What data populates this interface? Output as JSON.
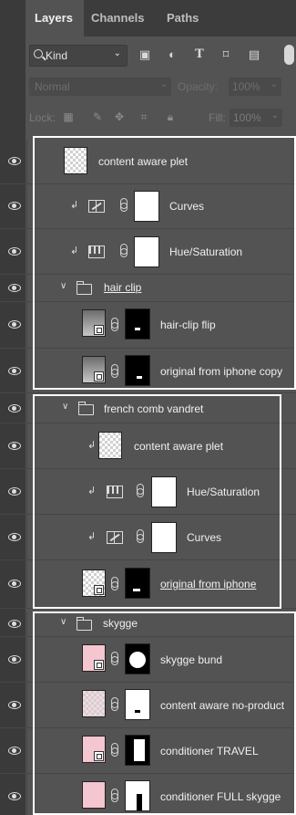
{
  "tabs": [
    {
      "label": "Layers",
      "active": true
    },
    {
      "label": "Channels",
      "active": false
    },
    {
      "label": "Paths",
      "active": false
    }
  ],
  "filter": {
    "kind_label": "Kind",
    "icons": [
      "image-filter-icon",
      "adjustment-filter-icon",
      "type-filter-icon",
      "shape-filter-icon",
      "smart-object-filter-icon"
    ],
    "type_glyph": "T"
  },
  "blend": {
    "mode": "Normal",
    "opacity_label": "Opacity:",
    "opacity_value": "100%"
  },
  "lock": {
    "label": "Lock:",
    "fill_label": "Fill:",
    "fill_value": "100%"
  },
  "colors": {
    "panel": "#535353",
    "tabbar": "#3c3c3c",
    "highlight_border": "#ffffff",
    "text": "#f0f0f0"
  },
  "layers": [
    {
      "name": "content aware plet",
      "kind": "pixel",
      "clipped": false,
      "underlined": false
    },
    {
      "name": "Curves",
      "kind": "curves",
      "clipped": true,
      "underlined": false
    },
    {
      "name": "Hue/Saturation",
      "kind": "hue",
      "clipped": true,
      "underlined": false
    },
    {
      "name": "hair clip",
      "kind": "group",
      "expanded": true,
      "underlined": true
    },
    {
      "name": "hair-clip flip",
      "kind": "smart",
      "underlined": false
    },
    {
      "name": "original from iphone copy",
      "kind": "smart",
      "underlined": false
    },
    {
      "name": "french comb vandret",
      "kind": "group",
      "expanded": true,
      "underlined": false
    },
    {
      "name": "content aware plet",
      "kind": "pixel",
      "clipped": true,
      "underlined": false
    },
    {
      "name": "Hue/Saturation",
      "kind": "hue",
      "clipped": true,
      "underlined": false
    },
    {
      "name": "Curves",
      "kind": "curves",
      "clipped": true,
      "underlined": false
    },
    {
      "name": "original from iphone",
      "kind": "smart",
      "underlined": true
    },
    {
      "name": "skygge",
      "kind": "group",
      "expanded": true,
      "underlined": false
    },
    {
      "name": "skygge bund",
      "kind": "smart",
      "underlined": false
    },
    {
      "name": "content aware no-product",
      "kind": "pixel",
      "underlined": false
    },
    {
      "name": "conditioner TRAVEL",
      "kind": "smart",
      "underlined": false
    },
    {
      "name": "conditioner FULL skygge",
      "kind": "smart",
      "underlined": false
    }
  ]
}
